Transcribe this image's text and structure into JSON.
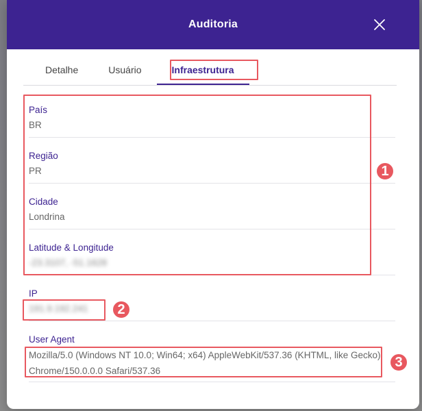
{
  "modal": {
    "title": "Auditoria"
  },
  "tabs": [
    {
      "label": "Detalhe"
    },
    {
      "label": "Usuário"
    },
    {
      "label": "Infraestrutura"
    }
  ],
  "fields": {
    "pais": {
      "label": "País",
      "value": "BR"
    },
    "regiao": {
      "label": "Região",
      "value": "PR"
    },
    "cidade": {
      "label": "Cidade",
      "value": "Londrina"
    },
    "latlng": {
      "label": "Latitude & Longitude",
      "value": "-23.3107, -51.1628"
    },
    "ip": {
      "label": "IP",
      "value": "191.9.192.241"
    },
    "user_agent": {
      "label": "User Agent",
      "value": "Mozilla/5.0 (Windows NT 10.0; Win64; x64) AppleWebKit/537.36 (KHTML, like Gecko) Chrome/150.0.0.0 Safari/537.36"
    }
  },
  "annotations": [
    "1",
    "2",
    "3"
  ],
  "colors": {
    "header": "#3d2391",
    "accent": "#3d2391",
    "highlight": "#e8585f"
  },
  "icons": {
    "close": "close-icon"
  }
}
